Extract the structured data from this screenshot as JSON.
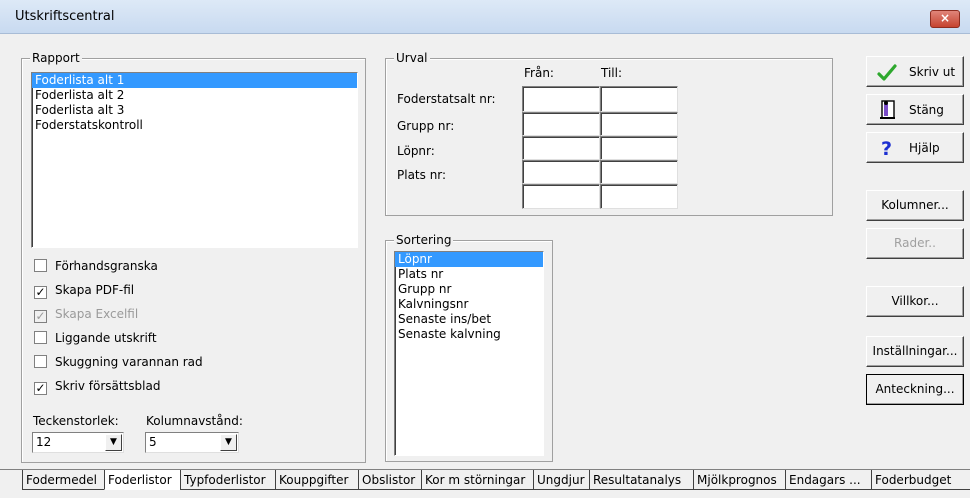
{
  "window": {
    "title": "Utskriftscentral",
    "close_label": "×"
  },
  "rapport": {
    "label": "Rapport",
    "items": [
      "Foderlista alt 1",
      "Foderlista alt 2",
      "Foderlista alt 3",
      "Foderstatskontroll"
    ],
    "selected_index": 0
  },
  "options": {
    "preview": {
      "label": "Förhandsgranska",
      "checked": false,
      "disabled": false
    },
    "pdf": {
      "label": "Skapa PDF-fil",
      "checked": true,
      "disabled": false
    },
    "excel": {
      "label": "Skapa Excelfil",
      "checked": true,
      "disabled": true
    },
    "landscape": {
      "label": "Liggande utskrift",
      "checked": false,
      "disabled": false
    },
    "shading": {
      "label": "Skuggning varannan rad",
      "checked": false,
      "disabled": false
    },
    "cover": {
      "label": "Skriv försättsblad",
      "checked": true,
      "disabled": false
    }
  },
  "font_size": {
    "label": "Teckenstorlek:",
    "value": "12"
  },
  "column_spacing": {
    "label": "Kolumnavstånd:",
    "value": "5"
  },
  "urval": {
    "label": "Urval",
    "from_label": "Från:",
    "to_label": "Till:",
    "rows": [
      "Foderstatsalt nr:",
      "Grupp nr:",
      "Löpnr:",
      "Plats nr:"
    ]
  },
  "sortering": {
    "label": "Sortering",
    "items": [
      "Löpnr",
      "Plats nr",
      "Grupp nr",
      "Kalvningsnr",
      "Senaste ins/bet",
      "Senaste kalvning"
    ],
    "selected_index": 0
  },
  "buttons": {
    "print": "Skriv ut",
    "close": "Stäng",
    "help": "Hjälp",
    "columns": "Kolumner...",
    "rows": "Rader..",
    "conditions": "Villkor...",
    "settings": "Inställningar...",
    "note": "Anteckning..."
  },
  "tabs": [
    "Fodermedel",
    "Foderlistor",
    "Typfoderlistor",
    "Kouppgifter",
    "Obslistor",
    "Kor m störningar",
    "Ungdjur",
    "Resultatanalys",
    "Mjölkprognos",
    "Endagars ...",
    "Foderbudget"
  ],
  "active_tab": 1,
  "colors": {
    "accent_selection": "#3399ff",
    "check_green": "#2ea82e",
    "help_blue": "#1c2fd1"
  }
}
